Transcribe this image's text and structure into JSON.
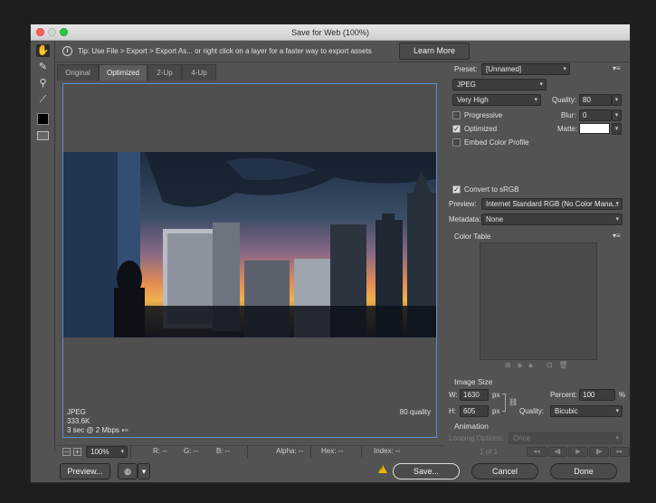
{
  "window": {
    "title": "Save for Web (100%)"
  },
  "tip": {
    "text": "Tip: Use File > Export > Export As...  or right click on a layer for a faster way to export assets",
    "learn_more": "Learn More"
  },
  "tools": [
    "hand-tool-icon",
    "slice-select-tool-icon",
    "zoom-tool-icon",
    "eyedropper-tool-icon",
    "eyedropper-color-swatch",
    "toggle-slices-icon"
  ],
  "tabs": [
    "Original",
    "Optimized",
    "2-Up",
    "4-Up"
  ],
  "active_tab": "Optimized",
  "preview_info": {
    "format": "JPEG",
    "size": "333.6K",
    "time": "3 sec @ 2 Mbps",
    "quality": "80 quality"
  },
  "status": {
    "zoom": "100%",
    "r": "R: --",
    "g": "G: --",
    "b": "B: --",
    "alpha": "Alpha: --",
    "hex": "Hex: --",
    "index": "Index: --"
  },
  "buttons": {
    "preview": "Preview...",
    "save": "Save...",
    "cancel": "Cancel",
    "done": "Done"
  },
  "settings": {
    "preset_label": "Preset:",
    "preset_value": "[Unnamed]",
    "format": "JPEG",
    "quality_level": "Very High",
    "quality_label": "Quality:",
    "quality_value": "80",
    "progressive": "Progressive",
    "blur_label": "Blur:",
    "blur_value": "0",
    "optimized": "Optimized",
    "matte_label": "Matte:",
    "embed_profile": "Embed Color Profile",
    "convert_srgb": "Convert to sRGB",
    "preview_label": "Preview:",
    "preview_value": "Internet Standard RGB (No Color Mana...",
    "metadata_label": "Metadata:",
    "metadata_value": "None",
    "color_table": "Color Table"
  },
  "image_size": {
    "heading": "Image Size",
    "w_label": "W:",
    "w_value": "1630",
    "h_label": "H:",
    "h_value": "605",
    "unit": "px",
    "percent_label": "Percent:",
    "percent_value": "100",
    "percent_unit": "%",
    "quality_label": "Quality:",
    "quality_value": "Bicubic"
  },
  "animation": {
    "heading": "Animation",
    "looping_label": "Looping Options:",
    "looping_value": "Once",
    "frame": "1 of 1"
  },
  "checks": {
    "progressive": false,
    "optimized": true,
    "embed_profile": false,
    "convert_srgb": true
  },
  "colors": {
    "accent": "#5b8ed0",
    "panel": "#535353",
    "matte": "#ffffff",
    "warning": "#e8b800"
  }
}
